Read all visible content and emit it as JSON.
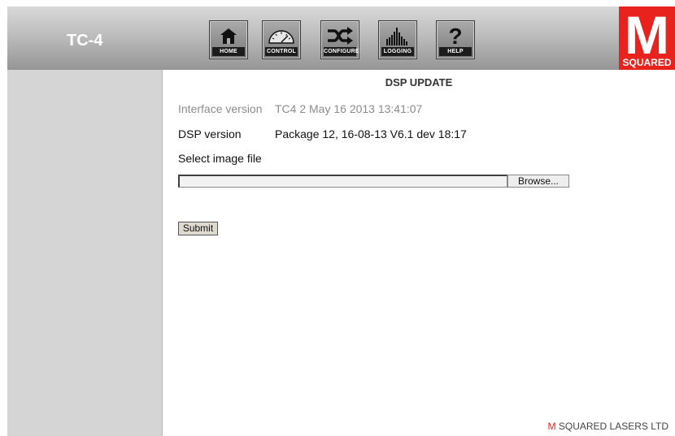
{
  "header": {
    "title": "TC-4",
    "nav": [
      {
        "label": "HOME",
        "icon": "home-icon"
      },
      {
        "label": "CONTROL",
        "icon": "gauge-icon"
      },
      {
        "label": "CONFIGURE",
        "icon": "shuffle-icon"
      },
      {
        "label": "LOGGING",
        "icon": "bar-graph-icon"
      },
      {
        "label": "HELP",
        "icon": "question-mark-icon"
      }
    ],
    "logo": {
      "letter": "M",
      "text": "SQUARED",
      "color": "#e8231d"
    }
  },
  "main": {
    "title": "DSP UPDATE",
    "interface_version": {
      "label": "Interface version",
      "value": "TC4 2 May 16 2013 13:41:07"
    },
    "dsp_version": {
      "label": "DSP version",
      "value": "Package 12, 16-08-13 V6.1 dev 18:17"
    },
    "select_label": "Select image file",
    "file_input_value": "",
    "browse_label": "Browse...",
    "submit_label": "Submit"
  },
  "footer": {
    "brand_m": "M",
    "brand_rest": " SQUARED LASERS LTD"
  }
}
